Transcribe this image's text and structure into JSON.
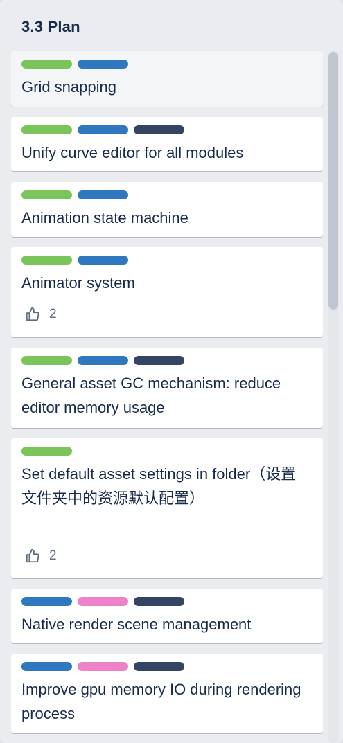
{
  "list": {
    "title": "3.3 Plan"
  },
  "label_colors": {
    "green": "#7bc45a",
    "blue": "#2f78c0",
    "dark": "#344563",
    "pink": "#ee82c8"
  },
  "cards": [
    {
      "labels": [
        "green",
        "blue"
      ],
      "title": "Grid snapping"
    },
    {
      "labels": [
        "green",
        "blue",
        "dark"
      ],
      "title": "Unify curve editor for all modules"
    },
    {
      "labels": [
        "green",
        "blue"
      ],
      "title": "Animation state machine"
    },
    {
      "labels": [
        "green",
        "blue"
      ],
      "title": "Animator system",
      "likes": "2"
    },
    {
      "labels": [
        "green",
        "blue",
        "dark"
      ],
      "title": "General asset GC mechanism: reduce editor memory usage"
    },
    {
      "labels": [
        "green"
      ],
      "title": "Set default asset settings in folder（设置文件夹中的资源默认配置）",
      "likes": "2"
    },
    {
      "labels": [
        "blue",
        "pink",
        "dark"
      ],
      "title": "Native render scene management"
    },
    {
      "labels": [
        "blue",
        "pink",
        "dark"
      ],
      "title": "Improve gpu memory IO during rendering process"
    }
  ],
  "icons": {
    "like": "thumbs-up-icon"
  }
}
